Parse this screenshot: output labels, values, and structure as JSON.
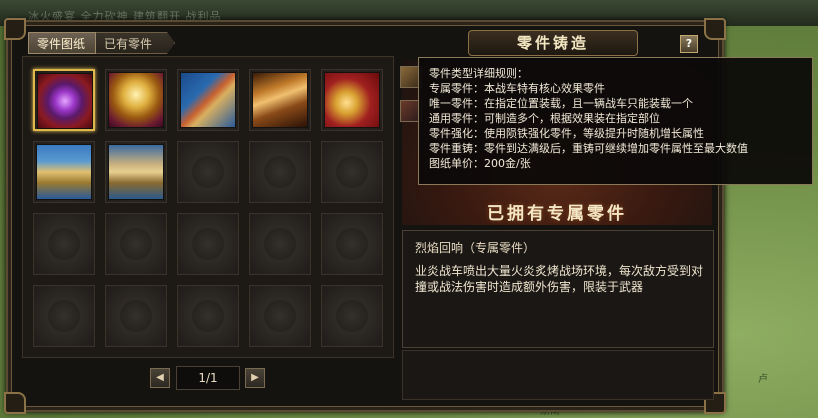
{
  "background": {
    "top_text": "冰火盛宴 全力砍神 建筑翻开  战利品",
    "right_text": "卢",
    "bottom_text": "斯南"
  },
  "tabs": [
    {
      "label": "零件图纸",
      "active": true
    },
    {
      "label": "已有零件",
      "active": false
    }
  ],
  "grid": {
    "slots": [
      {
        "icon": "core-part-icon",
        "filled": true,
        "selected": true
      },
      {
        "icon": "crown-part-icon",
        "filled": true,
        "selected": false
      },
      {
        "icon": "flag-part-icon",
        "filled": true,
        "selected": false
      },
      {
        "icon": "wing-part-icon",
        "filled": true,
        "selected": false
      },
      {
        "icon": "dragon-part-icon",
        "filled": true,
        "selected": false
      },
      {
        "icon": "wheel-part-icon",
        "filled": true,
        "selected": false
      },
      {
        "icon": "wheel-part-icon-2",
        "filled": true,
        "selected": false
      },
      {
        "filled": false
      },
      {
        "filled": false
      },
      {
        "filled": false
      },
      {
        "filled": false
      },
      {
        "filled": false
      },
      {
        "filled": false
      },
      {
        "filled": false
      },
      {
        "filled": false
      },
      {
        "filled": false
      },
      {
        "filled": false
      },
      {
        "filled": false
      },
      {
        "filled": false
      },
      {
        "filled": false
      }
    ]
  },
  "pager": {
    "text": "1/1",
    "prev": "◀",
    "next": "▶"
  },
  "right": {
    "title": "零件铸造",
    "help": "?",
    "owned_title": "已拥有专属零件"
  },
  "description": {
    "name": "烈焰回响（专属零件）",
    "body": "业炎战车喷出大量火炎炙烤战场环境，每次敌方受到对撞或战法伤害时造成额外伤害，限装于武器"
  },
  "tooltip": {
    "lines": [
      "零件类型详细规则：",
      "专属零件：本战车特有核心效果零件",
      "唯一零件：在指定位置装载，且一辆战车只能装载一个",
      "通用零件：可制造多个，根据效果装在指定部位",
      "零件强化：使用陨铁强化零件，等级提升时随机增长属性",
      "零件重铸：零件到达满级后，重铸可继续增加零件属性至最大数值",
      "图纸单价：200金/张"
    ]
  }
}
